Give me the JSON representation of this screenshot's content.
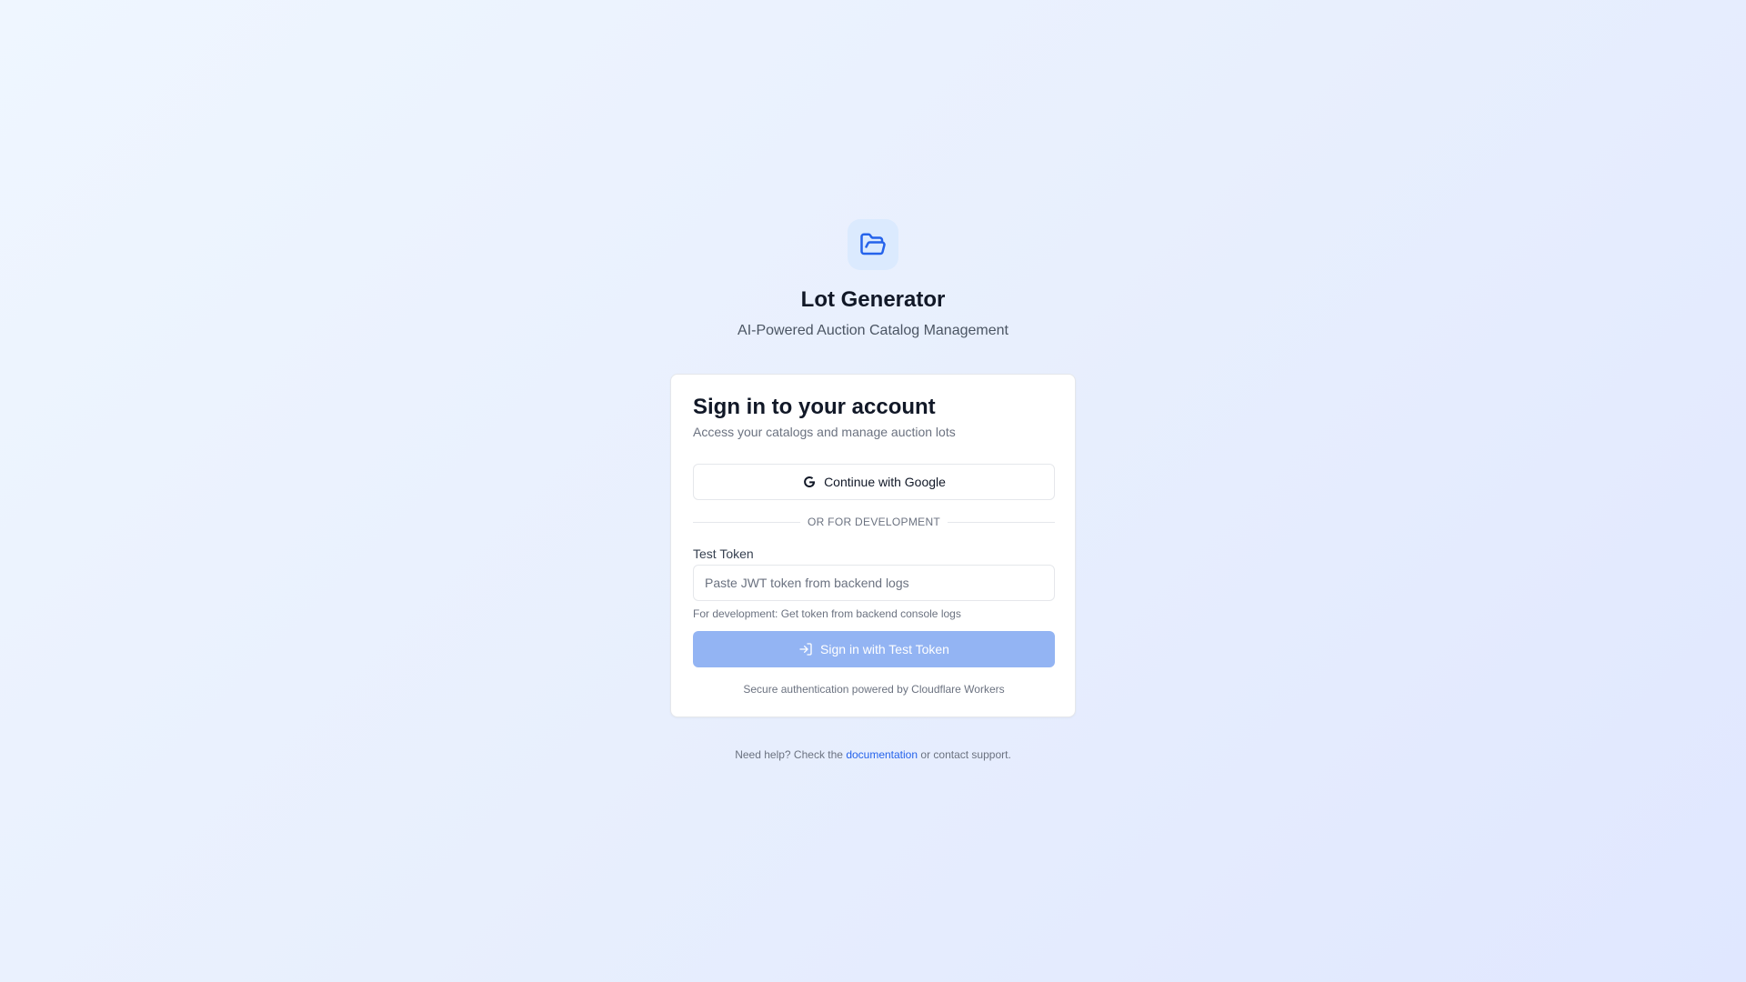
{
  "app": {
    "title": "Lot Generator",
    "subtitle": "AI-Powered Auction Catalog Management",
    "logo_icon": "folder-open-icon"
  },
  "card": {
    "title": "Sign in to your account",
    "description": "Access your catalogs and manage auction lots",
    "google_button_label": "Continue with Google",
    "google_icon": "google-icon",
    "divider_text": "OR FOR DEVELOPMENT",
    "token_label": "Test Token",
    "token_value": "",
    "token_placeholder": "Paste JWT token from backend logs",
    "token_help": "For development: Get token from backend console logs",
    "submit_label": "Sign in with Test Token",
    "submit_icon": "sign-in-icon",
    "submit_disabled": true,
    "footer": "Secure authentication powered by Cloudflare Workers"
  },
  "help": {
    "prefix": "Need help? Check the",
    "link_text": "documentation",
    "suffix": "or contact support."
  },
  "colors": {
    "accent": "#2563eb",
    "logo_tile": "#dbeafe",
    "submit_disabled_bg": "#93b4f3",
    "background_start": "#eff6ff",
    "background_end": "#e0e7ff"
  }
}
